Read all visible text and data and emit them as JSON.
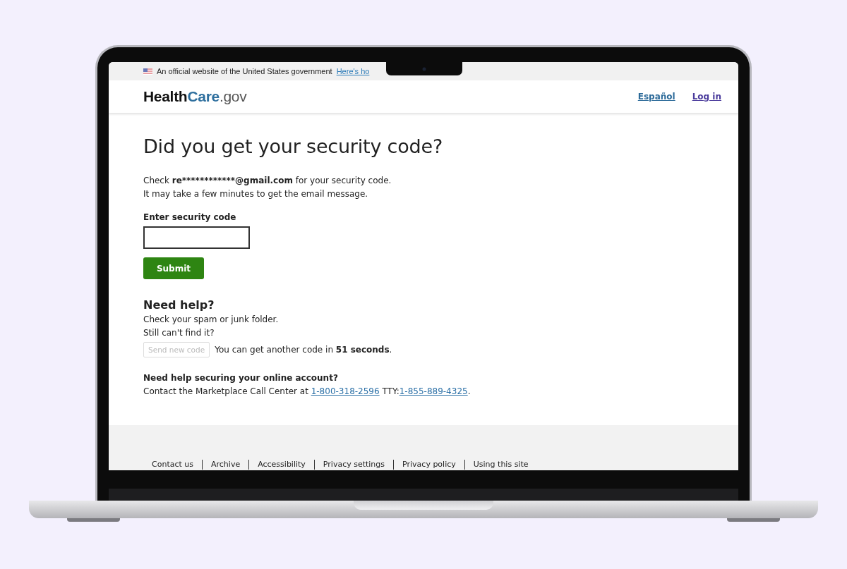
{
  "banner": {
    "text": "An official website of the United States government",
    "link": "Here's ho"
  },
  "header": {
    "logo": {
      "first": "Health",
      "second": "Care",
      "suffix": ".gov"
    },
    "links": [
      {
        "kind": "language",
        "label": "Español"
      },
      {
        "kind": "login",
        "label": "Log in"
      }
    ]
  },
  "main": {
    "title": "Did you get your security code?",
    "intro": {
      "before": "Check ",
      "email": "re************@gmail.com",
      "after": " for your security code."
    },
    "note": "It may take a few minutes to get the email message.",
    "field": {
      "label": "Enter security code"
    },
    "submit": "Submit",
    "help": {
      "heading": "Need help?",
      "lines": [
        "Check your spam or junk folder.",
        "Still can't find it?"
      ],
      "resend": {
        "label": "Send new code",
        "disabled": true
      },
      "countdown": "You can get another code in **51 seconds**."
    },
    "account": {
      "heading": "Need help securing your online account?",
      "before": "Contact the Marketplace Call Center at ",
      "phone": "1-800-318-2596",
      "tty_label": " TTY:",
      "tty": "1-855-889-4325",
      "end": "."
    }
  },
  "footer": {
    "links": [
      "Contact us",
      "Archive",
      "Accessibility",
      "Privacy settings",
      "Privacy policy",
      "Using this site"
    ]
  }
}
